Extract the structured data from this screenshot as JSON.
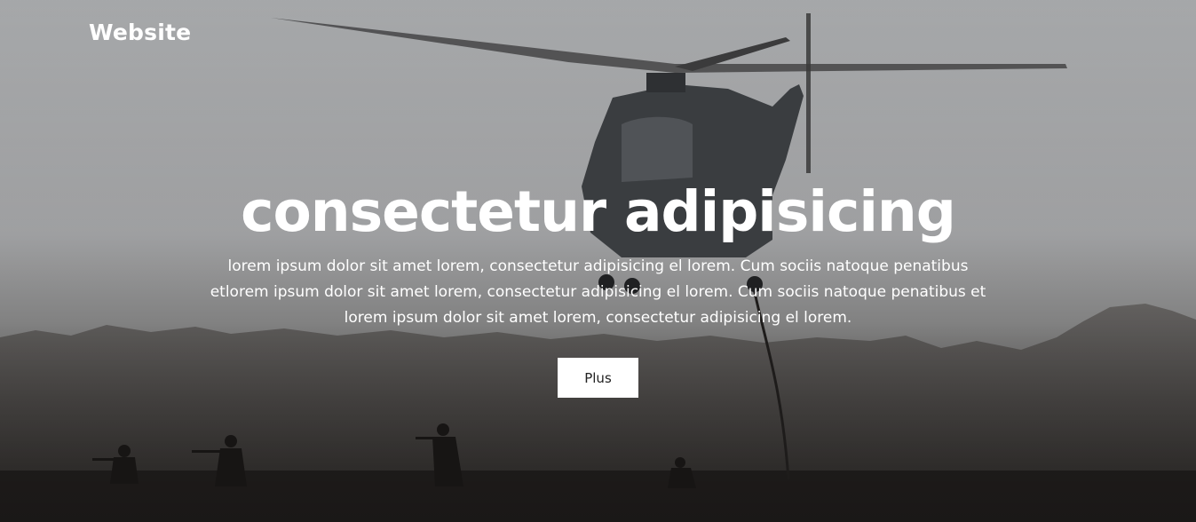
{
  "header": {
    "brand": "Website"
  },
  "hero": {
    "title": "consectetur adipisicing",
    "description": "lorem ipsum dolor sit amet lorem, consectetur adipisicing el lorem. Cum sociis natoque penatibus etlorem ipsum dolor sit amet lorem, consectetur adipisicing el lorem. Cum sociis natoque penatibus et lorem ipsum dolor sit amet lorem, consectetur adipisicing el lorem.",
    "button_label": "Plus",
    "background_image": "military-helicopter-rappel-photo"
  },
  "colors": {
    "text": "#ffffff",
    "button_bg": "#ffffff",
    "button_text": "#222222",
    "sky": "#b3b5b7",
    "ground": "#2a2725"
  }
}
